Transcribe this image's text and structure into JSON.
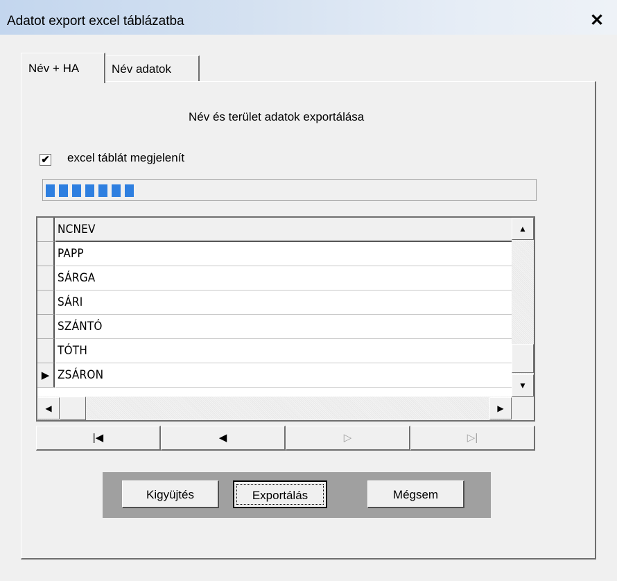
{
  "window": {
    "title": "Adatot export excel táblázatba",
    "close_label": "✕"
  },
  "tabs": [
    {
      "label": "Név + HA",
      "active": true
    },
    {
      "label": "Név adatok",
      "active": false
    }
  ],
  "panel": {
    "heading": "Név és terület adatok exportálása",
    "checkbox": {
      "checked": true,
      "mark": "✔",
      "label": "excel táblát megjelenít"
    },
    "progress": {
      "segments_filled": 7
    }
  },
  "grid": {
    "column_header": "NCNEV",
    "rows": [
      {
        "value": "PAPP",
        "current": false
      },
      {
        "value": "SÁRGA",
        "current": false
      },
      {
        "value": "SÁRI",
        "current": false
      },
      {
        "value": "SZÁNTÓ",
        "current": false
      },
      {
        "value": "TÓTH",
        "current": false
      },
      {
        "value": "ZSÁRON",
        "current": true
      }
    ],
    "current_marker": "▶",
    "scroll_up_icon": "▲",
    "scroll_down_icon": "▼",
    "scroll_left_icon": "◀",
    "scroll_right_icon": "▶"
  },
  "navigator": {
    "first_icon": "|◀",
    "prev_icon": "◀",
    "next_icon": "▷",
    "last_icon": "▷|"
  },
  "buttons": {
    "collect": "Kigyüjtés",
    "export": "Exportálás",
    "cancel": "Mégsem"
  }
}
